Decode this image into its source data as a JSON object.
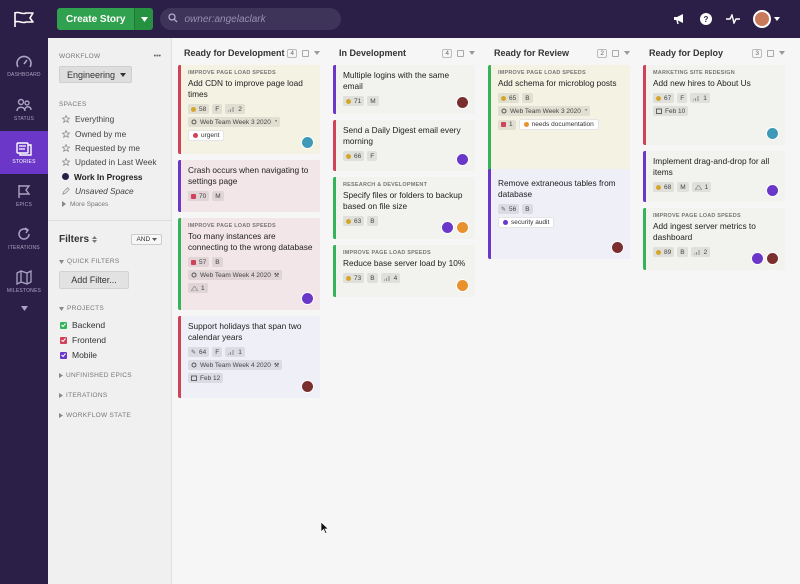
{
  "topbar": {
    "create_label": "Create Story",
    "search_placeholder": "owner:angelaclark",
    "icons": [
      "flag-logo-icon",
      "megaphone-icon",
      "help-icon",
      "activity-icon",
      "avatar"
    ]
  },
  "nav": {
    "items": [
      {
        "label": "DASHBOARD",
        "icon": "dashboard-icon",
        "active": false
      },
      {
        "label": "STATUS",
        "icon": "status-icon",
        "active": false
      },
      {
        "label": "STORIES",
        "icon": "stories-icon",
        "active": true
      },
      {
        "label": "EPICS",
        "icon": "epics-icon",
        "active": false
      },
      {
        "label": "ITERATIONS",
        "icon": "iterations-icon",
        "active": false
      },
      {
        "label": "MILESTONES",
        "icon": "milestones-icon",
        "active": false
      }
    ]
  },
  "sidebar": {
    "workflow_heading": "WORKFLOW",
    "workflow_more": "•••",
    "workflow_value": "Engineering",
    "spaces_heading": "SPACES",
    "spaces": [
      {
        "label": "Everything",
        "icon": "star-icon"
      },
      {
        "label": "Owned by me",
        "icon": "star-icon"
      },
      {
        "label": "Requested by me",
        "icon": "star-icon"
      },
      {
        "label": "Updated in Last Week",
        "icon": "star-icon"
      },
      {
        "label": "Work In Progress",
        "icon": "filled-dot-icon"
      },
      {
        "label": "Unsaved Space",
        "icon": "edit-icon"
      }
    ],
    "more_spaces": "More Spaces",
    "filters_heading": "Filters",
    "filters_operator": "AND",
    "quick_filters": "QUICK FILTERS",
    "add_filter": "Add Filter...",
    "projects_heading": "PROJECTS",
    "projects": [
      {
        "label": "Backend",
        "color": "#36b35a"
      },
      {
        "label": "Frontend",
        "color": "#d14157"
      },
      {
        "label": "Mobile",
        "color": "#6a37c8"
      }
    ],
    "unfinished_epics": "UNFINISHED EPICS",
    "iterations": "ITERATIONS",
    "workflow_state": "WORKFLOW STATE"
  },
  "columns": [
    {
      "title": "Ready for Development",
      "count": "4",
      "cards": [
        {
          "epic": "IMPROVE PAGE LOAD SPEEDS",
          "title": "Add CDN to improve page load times",
          "id": "58",
          "est": "F",
          "size": "2",
          "iteration": "Web Team Week 3 2020",
          "labels": [
            {
              "text": "urgent",
              "color": "#d14157"
            }
          ]
        },
        {
          "epic": "",
          "title": "Crash occurs when navigating to settings page",
          "id": "70",
          "est": "M"
        },
        {
          "epic": "IMPROVE PAGE LOAD SPEEDS",
          "title": "Too many instances are connecting to the wrong database",
          "id": "57",
          "est": "B",
          "iteration": "Web Team Week 4 2020",
          "size": "1"
        },
        {
          "epic": "",
          "title": "Support holidays that span two calendar years",
          "id": "64",
          "est": "F",
          "size": "1",
          "iteration": "Web Team Week 4 2020",
          "date": "Feb 12"
        }
      ]
    },
    {
      "title": "In Development",
      "count": "4",
      "cards": [
        {
          "epic": "",
          "title": "Multiple logins with the same email",
          "id": "71",
          "est": "M"
        },
        {
          "epic": "",
          "title": "Send a Daily Digest email every morning",
          "id": "66",
          "est": "F"
        },
        {
          "epic": "RESEARCH & DEVELOPMENT",
          "title": "Specify files or folders to backup based on file size",
          "id": "63",
          "est": "B"
        },
        {
          "epic": "IMPROVE PAGE LOAD SPEEDS",
          "title": "Reduce base server load by 10%",
          "id": "73",
          "est": "B",
          "size": "4"
        }
      ]
    },
    {
      "title": "Ready for Review",
      "count": "2",
      "cards": [
        {
          "epic": "IMPROVE PAGE LOAD SPEEDS",
          "title": "Add schema for microblog posts",
          "id": "65",
          "est": "B",
          "iteration": "Web Team Week 3 2020",
          "blocker": "1",
          "labels": [
            {
              "text": "needs documentation",
              "color": "#e8912d"
            }
          ]
        },
        {
          "epic": "",
          "title": "Remove extraneous tables from database",
          "id": "56",
          "est": "B",
          "labels": [
            {
              "text": "security audit",
              "color": "#6a37c8"
            }
          ]
        }
      ]
    },
    {
      "title": "Ready for Deploy",
      "count": "3",
      "cards": [
        {
          "epic": "MARKETING SITE REDESIGN",
          "title": "Add new hires to About Us",
          "id": "67",
          "est": "F",
          "size": "1",
          "date": "Feb 10"
        },
        {
          "epic": "",
          "title": "Implement drag-and-drop for all items",
          "id": "68",
          "est": "M",
          "size": "1"
        },
        {
          "epic": "IMPROVE PAGE LOAD SPEEDS",
          "title": "Add ingest server metrics to dashboard",
          "id": "89",
          "est": "B",
          "size": "2"
        }
      ]
    }
  ]
}
